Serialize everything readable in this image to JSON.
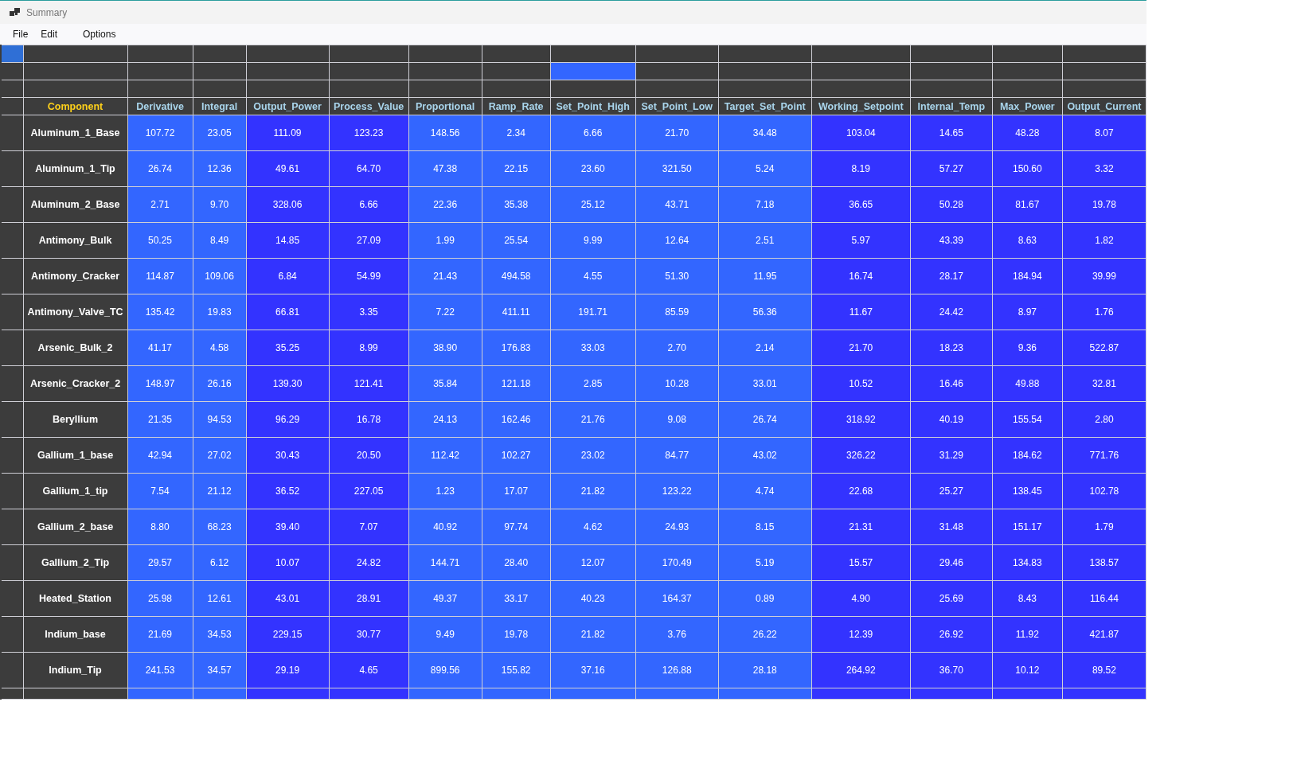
{
  "window": {
    "title": "Summary"
  },
  "menu": [
    "File",
    "Edit",
    "Options"
  ],
  "grid": {
    "corner_selected": true,
    "component_header": "Component",
    "columns": [
      {
        "label": "Derivative",
        "color": "#3366ff",
        "selected": false
      },
      {
        "label": "Integral",
        "color": "#3366ff",
        "selected": false
      },
      {
        "label": "Output_Power",
        "color": "#3333ff",
        "selected": false
      },
      {
        "label": "Process_Value",
        "color": "#3333ff",
        "selected": false
      },
      {
        "label": "Proportional",
        "color": "#3366ff",
        "selected": false
      },
      {
        "label": "Ramp_Rate",
        "color": "#3366ff",
        "selected": false
      },
      {
        "label": "Set_Point_High",
        "color": "#3366ff",
        "selected": true
      },
      {
        "label": "Set_Point_Low",
        "color": "#3366ff",
        "selected": false
      },
      {
        "label": "Target_Set_Point",
        "color": "#3366ff",
        "selected": false
      },
      {
        "label": "Working_Setpoint",
        "color": "#3333ff",
        "selected": false
      },
      {
        "label": "Internal_Temp",
        "color": "#3333ff",
        "selected": false
      },
      {
        "label": "Max_Power",
        "color": "#3333ff",
        "selected": false
      },
      {
        "label": "Output_Current",
        "color": "#3333ff",
        "selected": false
      }
    ],
    "rows": [
      {
        "component": "Aluminum_1_Base",
        "values": [
          "107.72",
          "23.05",
          "111.09",
          "123.23",
          "148.56",
          "2.34",
          "6.66",
          "21.70",
          "34.48",
          "103.04",
          "14.65",
          "48.28",
          "8.07"
        ]
      },
      {
        "component": "Aluminum_1_Tip",
        "values": [
          "26.74",
          "12.36",
          "49.61",
          "64.70",
          "47.38",
          "22.15",
          "23.60",
          "321.50",
          "5.24",
          "8.19",
          "57.27",
          "150.60",
          "3.32"
        ]
      },
      {
        "component": "Aluminum_2_Base",
        "values": [
          "2.71",
          "9.70",
          "328.06",
          "6.66",
          "22.36",
          "35.38",
          "25.12",
          "43.71",
          "7.18",
          "36.65",
          "50.28",
          "81.67",
          "19.78"
        ]
      },
      {
        "component": "Antimony_Bulk",
        "values": [
          "50.25",
          "8.49",
          "14.85",
          "27.09",
          "1.99",
          "25.54",
          "9.99",
          "12.64",
          "2.51",
          "5.97",
          "43.39",
          "8.63",
          "1.82"
        ]
      },
      {
        "component": "Antimony_Cracker",
        "values": [
          "114.87",
          "109.06",
          "6.84",
          "54.99",
          "21.43",
          "494.58",
          "4.55",
          "51.30",
          "11.95",
          "16.74",
          "28.17",
          "184.94",
          "39.99"
        ]
      },
      {
        "component": "Antimony_Valve_TC",
        "values": [
          "135.42",
          "19.83",
          "66.81",
          "3.35",
          "7.22",
          "411.11",
          "191.71",
          "85.59",
          "56.36",
          "11.67",
          "24.42",
          "8.97",
          "1.76"
        ]
      },
      {
        "component": "Arsenic_Bulk_2",
        "values": [
          "41.17",
          "4.58",
          "35.25",
          "8.99",
          "38.90",
          "176.83",
          "33.03",
          "2.70",
          "2.14",
          "21.70",
          "18.23",
          "9.36",
          "522.87"
        ]
      },
      {
        "component": "Arsenic_Cracker_2",
        "values": [
          "148.97",
          "26.16",
          "139.30",
          "121.41",
          "35.84",
          "121.18",
          "2.85",
          "10.28",
          "33.01",
          "10.52",
          "16.46",
          "49.88",
          "32.81"
        ]
      },
      {
        "component": "Beryllium",
        "values": [
          "21.35",
          "94.53",
          "96.29",
          "16.78",
          "24.13",
          "162.46",
          "21.76",
          "9.08",
          "26.74",
          "318.92",
          "40.19",
          "155.54",
          "2.80"
        ]
      },
      {
        "component": "Gallium_1_base",
        "values": [
          "42.94",
          "27.02",
          "30.43",
          "20.50",
          "112.42",
          "102.27",
          "23.02",
          "84.77",
          "43.02",
          "326.22",
          "31.29",
          "184.62",
          "771.76"
        ]
      },
      {
        "component": "Gallium_1_tip",
        "values": [
          "7.54",
          "21.12",
          "36.52",
          "227.05",
          "1.23",
          "17.07",
          "21.82",
          "123.22",
          "4.74",
          "22.68",
          "25.27",
          "138.45",
          "102.78"
        ]
      },
      {
        "component": "Gallium_2_base",
        "values": [
          "8.80",
          "68.23",
          "39.40",
          "7.07",
          "40.92",
          "97.74",
          "4.62",
          "24.93",
          "8.15",
          "21.31",
          "31.48",
          "151.17",
          "1.79"
        ]
      },
      {
        "component": "Gallium_2_Tip",
        "values": [
          "29.57",
          "6.12",
          "10.07",
          "24.82",
          "144.71",
          "28.40",
          "12.07",
          "170.49",
          "5.19",
          "15.57",
          "29.46",
          "134.83",
          "138.57"
        ]
      },
      {
        "component": "Heated_Station",
        "values": [
          "25.98",
          "12.61",
          "43.01",
          "28.91",
          "49.37",
          "33.17",
          "40.23",
          "164.37",
          "0.89",
          "4.90",
          "25.69",
          "8.43",
          "116.44"
        ]
      },
      {
        "component": "Indium_base",
        "values": [
          "21.69",
          "34.53",
          "229.15",
          "30.77",
          "9.49",
          "19.78",
          "21.82",
          "3.76",
          "26.22",
          "12.39",
          "26.92",
          "11.92",
          "421.87"
        ]
      },
      {
        "component": "Indium_Tip",
        "values": [
          "241.53",
          "34.57",
          "29.19",
          "4.65",
          "899.56",
          "155.82",
          "37.16",
          "126.88",
          "28.18",
          "264.92",
          "36.70",
          "10.12",
          "89.52"
        ]
      }
    ]
  }
}
